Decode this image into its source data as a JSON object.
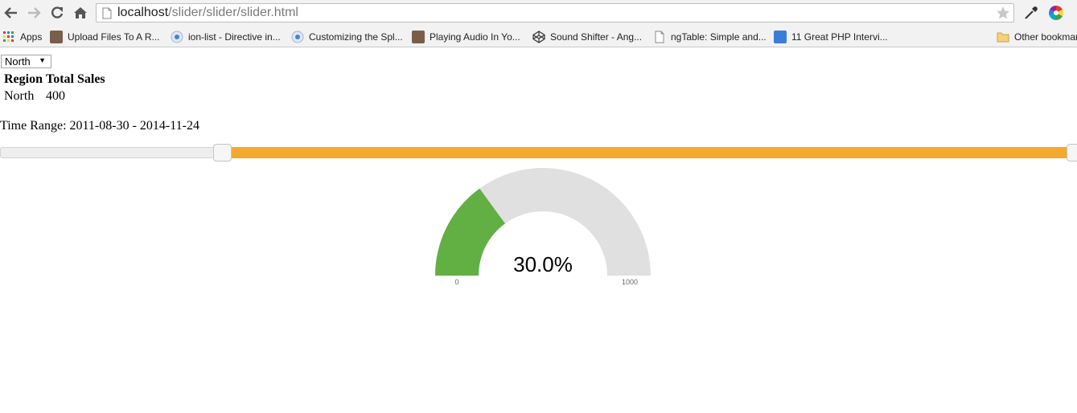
{
  "browser": {
    "url_host": "localhost",
    "url_path": "/slider/slider/slider.html",
    "bookmarks": [
      {
        "label": "Apps",
        "icon": "apps-grid-icon"
      },
      {
        "label": "Upload Files To A R...",
        "icon": "site-favicon"
      },
      {
        "label": "ion-list - Directive in...",
        "icon": "chrome-page-icon"
      },
      {
        "label": "Customizing the Spl...",
        "icon": "chrome-page-icon"
      },
      {
        "label": "Playing Audio In Yo...",
        "icon": "site-favicon"
      },
      {
        "label": "Sound Shifter - Ang...",
        "icon": "codepen-icon"
      },
      {
        "label": "ngTable: Simple and...",
        "icon": "page-icon"
      },
      {
        "label": "11 Great PHP Intervi...",
        "icon": "site-favicon-blue"
      }
    ],
    "other_bookmarks": "Other bookmarks"
  },
  "region_select": {
    "selected": "North"
  },
  "table": {
    "headers": [
      "Region",
      "Total Sales"
    ],
    "rows": [
      [
        "North",
        "400"
      ]
    ]
  },
  "time_range": {
    "label": "Time Range: 2011-08-30 - 2014-11-24"
  },
  "slider": {
    "low_fraction": 0.207,
    "high_fraction": 1.0,
    "fill_color": "#f4a82e"
  },
  "gauge": {
    "value_text": "30.0%",
    "value_fraction": 0.3,
    "min": "0",
    "max": "1000",
    "fill_color": "#62af44",
    "track_color": "#e0e0e0"
  }
}
